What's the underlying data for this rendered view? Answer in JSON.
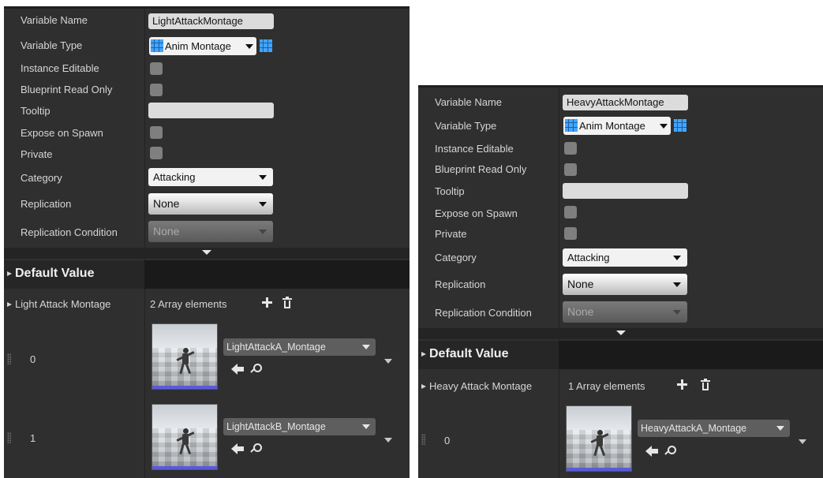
{
  "left_panel": {
    "props": {
      "variable_name_label": "Variable Name",
      "variable_name_value": "LightAttackMontage",
      "variable_type_label": "Variable Type",
      "variable_type_value": "Anim Montage",
      "instance_editable_label": "Instance Editable",
      "blueprint_read_only_label": "Blueprint Read Only",
      "tooltip_label": "Tooltip",
      "tooltip_value": "",
      "expose_on_spawn_label": "Expose on Spawn",
      "private_label": "Private",
      "category_label": "Category",
      "category_value": "Attacking",
      "replication_label": "Replication",
      "replication_value": "None",
      "replication_condition_label": "Replication Condition",
      "replication_condition_value": "None"
    },
    "default_value": {
      "title": "Default Value",
      "array_label": "Light Attack Montage",
      "array_count": "2 Array elements",
      "elements": [
        {
          "index": "0",
          "asset": "LightAttackA_Montage"
        },
        {
          "index": "1",
          "asset": "LightAttackB_Montage"
        }
      ]
    }
  },
  "right_panel": {
    "props": {
      "variable_name_label": "Variable Name",
      "variable_name_value": "HeavyAttackMontage",
      "variable_type_label": "Variable Type",
      "variable_type_value": "Anim Montage",
      "instance_editable_label": "Instance Editable",
      "blueprint_read_only_label": "Blueprint Read Only",
      "tooltip_label": "Tooltip",
      "tooltip_value": "",
      "expose_on_spawn_label": "Expose on Spawn",
      "private_label": "Private",
      "category_label": "Category",
      "category_value": "Attacking",
      "replication_label": "Replication",
      "replication_value": "None",
      "replication_condition_label": "Replication Condition",
      "replication_condition_value": "None"
    },
    "default_value": {
      "title": "Default Value",
      "array_label": "Heavy Attack Montage",
      "array_count": "1 Array elements",
      "elements": [
        {
          "index": "0",
          "asset": "HeavyAttackA_Montage"
        }
      ]
    }
  },
  "colors": {
    "panel_bg": "#2f2f2f",
    "array_icon": "#43a5ff",
    "thumb_bar": "#5a5adc"
  },
  "icons": [
    "array-grid-icon",
    "plus-icon",
    "trash-icon",
    "back-arrow-icon",
    "search-icon",
    "grip-icon",
    "chevron-down-icon"
  ]
}
